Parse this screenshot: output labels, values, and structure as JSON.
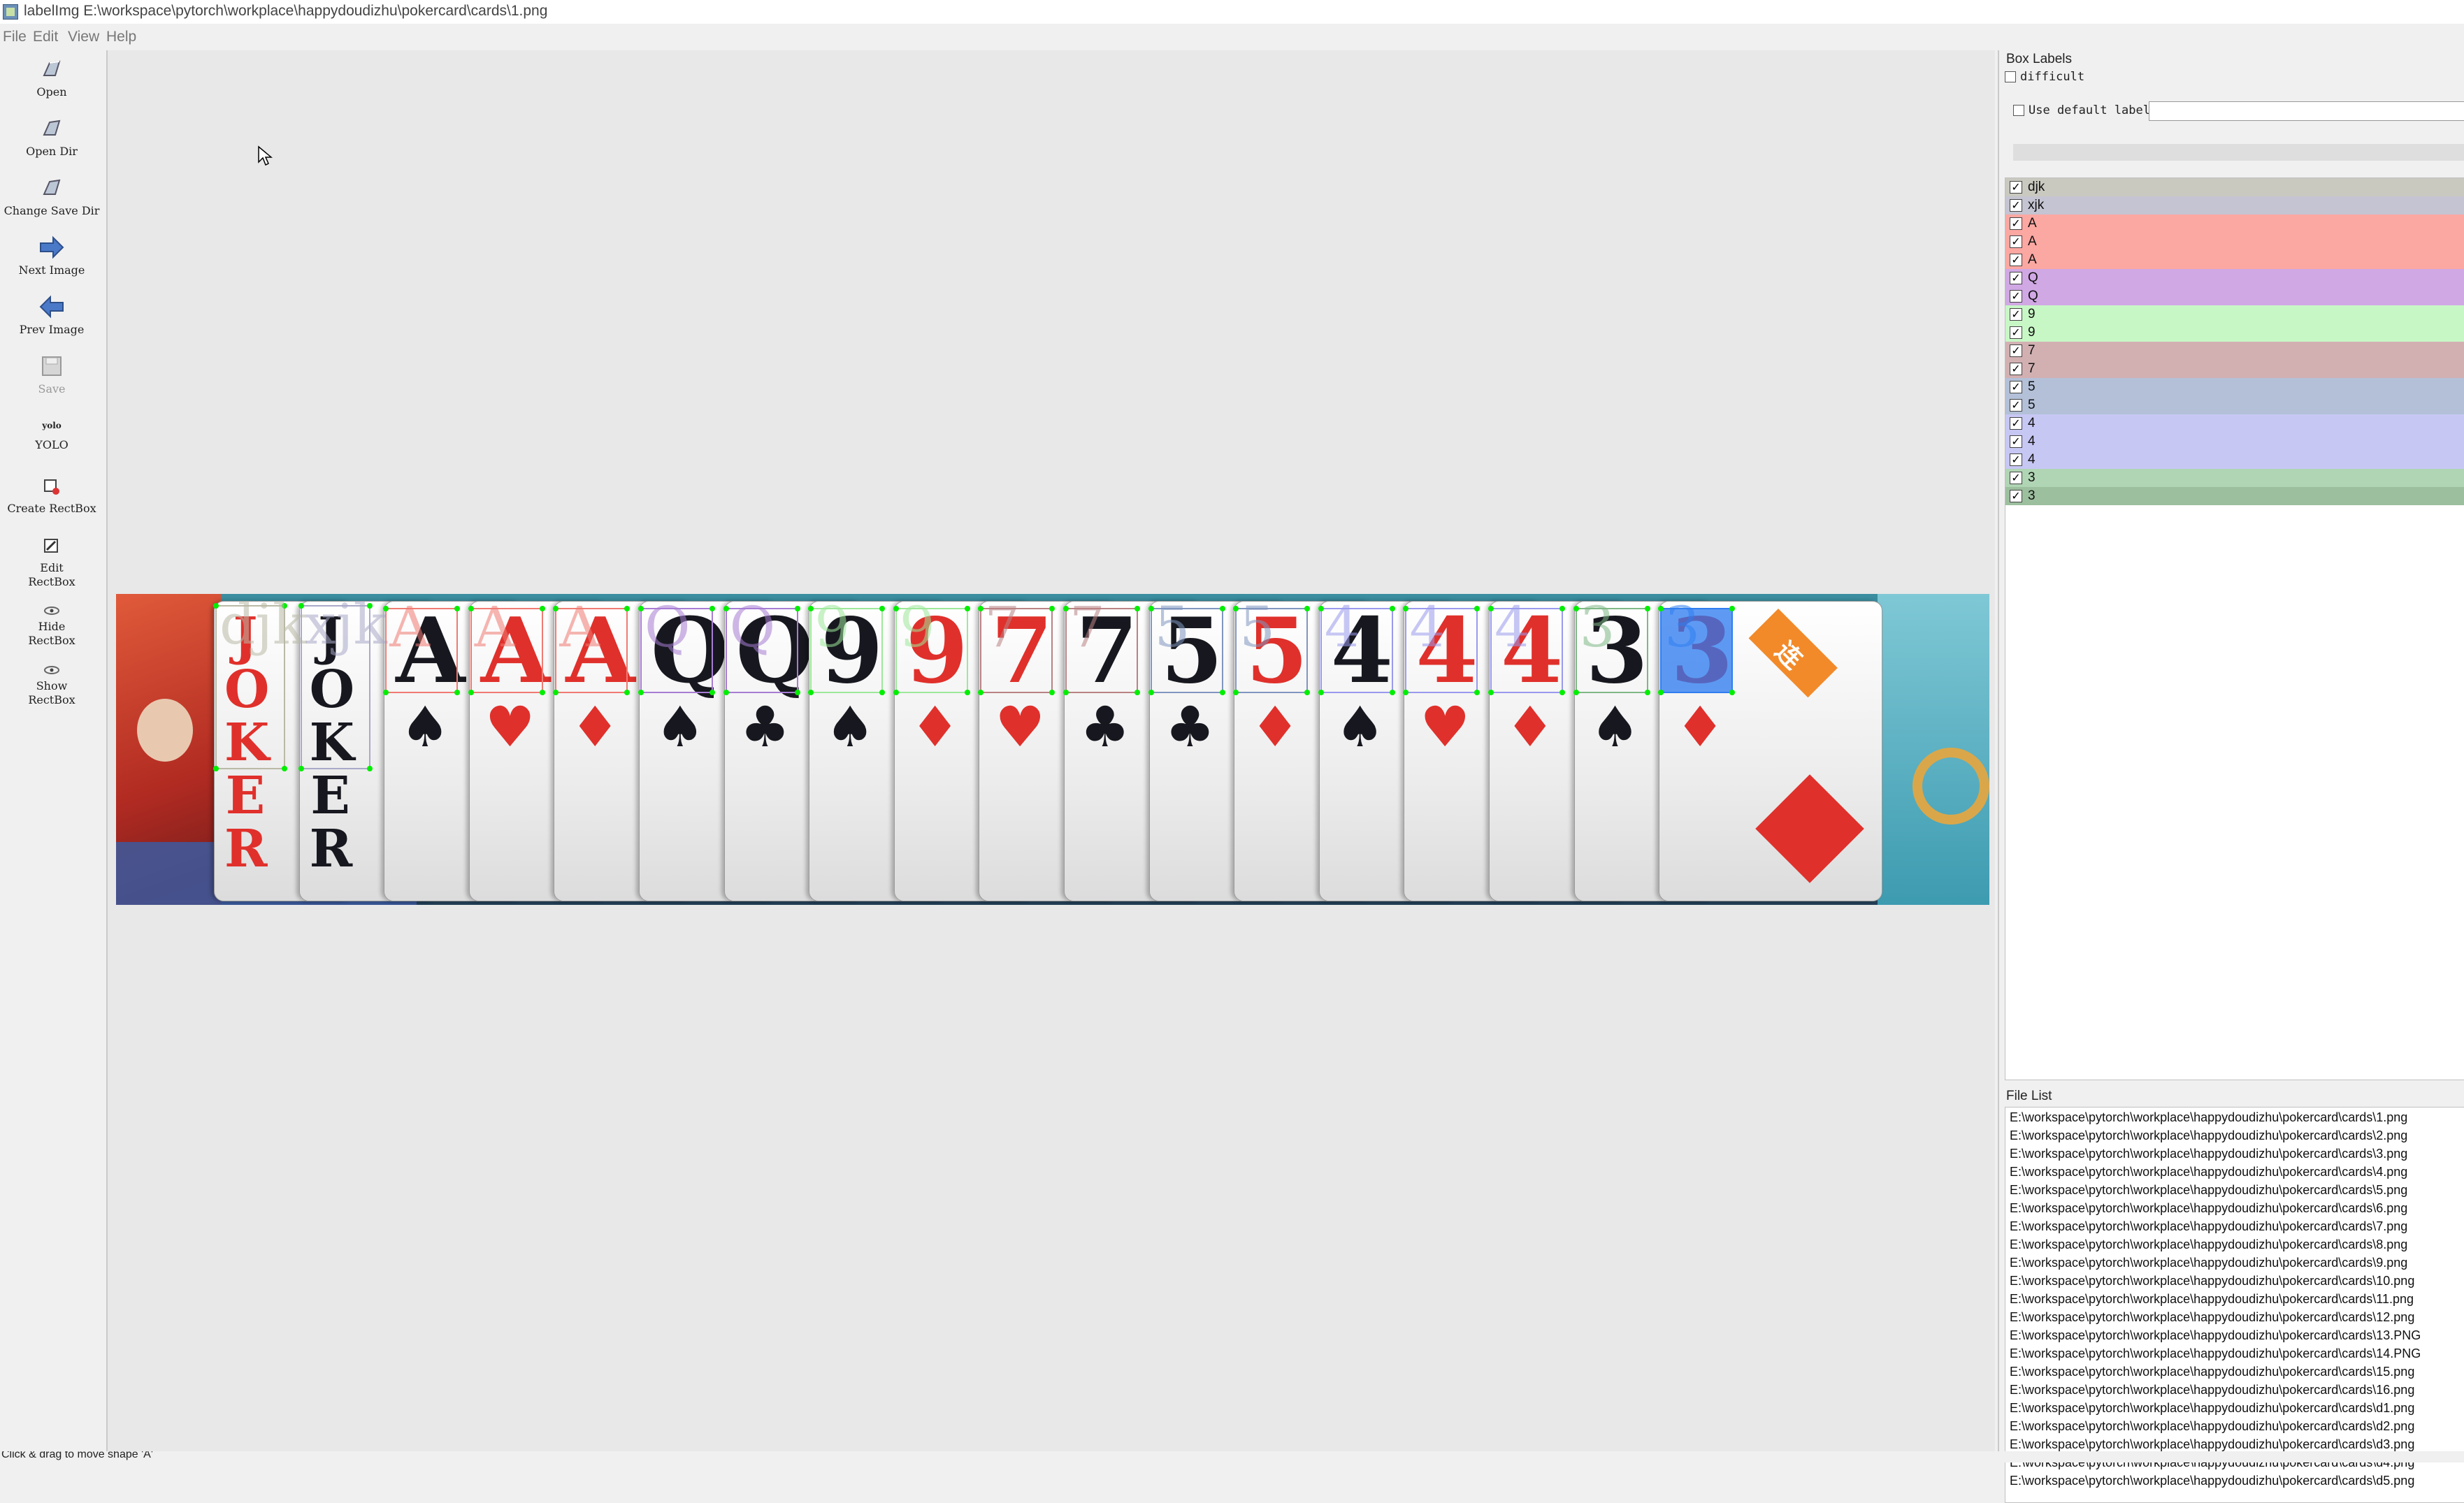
{
  "window": {
    "title": "labelImg E:\\workspace\\pytorch\\workplace\\happydoudizhu\\pokercard\\cards\\1.png",
    "icon": "labelimg-app-icon"
  },
  "menu": [
    "File",
    "Edit",
    "View",
    "Help"
  ],
  "toolbar": [
    {
      "label": "Open",
      "icon": "open-folder-icon",
      "enabled": true
    },
    {
      "label": "Open Dir",
      "icon": "open-dir-icon",
      "enabled": true
    },
    {
      "label": "Change Save Dir",
      "icon": "change-save-dir-icon",
      "enabled": true
    },
    {
      "label": "Next Image",
      "icon": "next-arrow-icon",
      "enabled": true
    },
    {
      "label": "Prev Image",
      "icon": "prev-arrow-icon",
      "enabled": true
    },
    {
      "label": "Save",
      "icon": "save-icon",
      "enabled": false
    },
    {
      "label": "YOLO",
      "icon_text": "yolo",
      "icon": "yolo-format-icon",
      "enabled": true
    },
    {
      "label": "Create RectBox",
      "icon": "create-rectbox-icon",
      "enabled": true
    },
    {
      "label": "Edit RectBox",
      "icon": "edit-rectbox-icon",
      "enabled": true
    },
    {
      "label": "Hide RectBox",
      "icon": "eye-icon",
      "enabled": true
    },
    {
      "label": "Show RectBox",
      "icon": "eye-icon",
      "enabled": true
    }
  ],
  "cards": [
    {
      "rank": "JOKER",
      "suit": "",
      "color": "red"
    },
    {
      "rank": "JOKER",
      "suit": "",
      "color": "black"
    },
    {
      "rank": "A",
      "suit": "♠",
      "color": "black"
    },
    {
      "rank": "A",
      "suit": "♥",
      "color": "red"
    },
    {
      "rank": "A",
      "suit": "♦",
      "color": "red"
    },
    {
      "rank": "Q",
      "suit": "♠",
      "color": "black"
    },
    {
      "rank": "Q",
      "suit": "♣",
      "color": "black"
    },
    {
      "rank": "9",
      "suit": "♠",
      "color": "black"
    },
    {
      "rank": "9",
      "suit": "♦",
      "color": "red"
    },
    {
      "rank": "7",
      "suit": "♥",
      "color": "red"
    },
    {
      "rank": "7",
      "suit": "♣",
      "color": "black"
    },
    {
      "rank": "5",
      "suit": "♣",
      "color": "black"
    },
    {
      "rank": "5",
      "suit": "♦",
      "color": "red"
    },
    {
      "rank": "4",
      "suit": "♠",
      "color": "black"
    },
    {
      "rank": "4",
      "suit": "♥",
      "color": "red"
    },
    {
      "rank": "4",
      "suit": "♦",
      "color": "red"
    },
    {
      "rank": "3",
      "suit": "♠",
      "color": "black"
    },
    {
      "rank": "3",
      "suit": "♦",
      "color": "red"
    }
  ],
  "box_overlay_labels": [
    "djk",
    "xjk",
    "A",
    "A",
    "A",
    "Q",
    "Q",
    "9",
    "9",
    "7",
    "7",
    "5",
    "5",
    "4",
    "4",
    "4",
    "3",
    "3"
  ],
  "ribbon_text": "连",
  "box_labels_panel": {
    "title": "Box Labels",
    "difficult": "difficult",
    "use_default": "Use default label",
    "default_value": ""
  },
  "labels": [
    {
      "text": "djk",
      "color": "#c9c9c0"
    },
    {
      "text": "xjk",
      "color": "#c4c4d2"
    },
    {
      "text": "A",
      "color": "#fba7a2"
    },
    {
      "text": "A",
      "color": "#fba7a2"
    },
    {
      "text": "A",
      "color": "#fba7a2"
    },
    {
      "text": "Q",
      "color": "#d0a8e4"
    },
    {
      "text": "Q",
      "color": "#d0a8e4"
    },
    {
      "text": "9",
      "color": "#c8f7c6"
    },
    {
      "text": "9",
      "color": "#c8f7c6"
    },
    {
      "text": "7",
      "color": "#d2b0b2"
    },
    {
      "text": "7",
      "color": "#d2b0b2"
    },
    {
      "text": "5",
      "color": "#b3c0d8"
    },
    {
      "text": "5",
      "color": "#b3c0d8"
    },
    {
      "text": "4",
      "color": "#c7c7f4"
    },
    {
      "text": "4",
      "color": "#c7c7f4"
    },
    {
      "text": "4",
      "color": "#c7c7f4"
    },
    {
      "text": "3",
      "color": "#b0d5b4"
    },
    {
      "text": "3",
      "color": "#9cbf9e"
    }
  ],
  "file_list": {
    "title": "File List",
    "files": [
      "E:\\workspace\\pytorch\\workplace\\happydoudizhu\\pokercard\\cards\\1.png",
      "E:\\workspace\\pytorch\\workplace\\happydoudizhu\\pokercard\\cards\\2.png",
      "E:\\workspace\\pytorch\\workplace\\happydoudizhu\\pokercard\\cards\\3.png",
      "E:\\workspace\\pytorch\\workplace\\happydoudizhu\\pokercard\\cards\\4.png",
      "E:\\workspace\\pytorch\\workplace\\happydoudizhu\\pokercard\\cards\\5.png",
      "E:\\workspace\\pytorch\\workplace\\happydoudizhu\\pokercard\\cards\\6.png",
      "E:\\workspace\\pytorch\\workplace\\happydoudizhu\\pokercard\\cards\\7.png",
      "E:\\workspace\\pytorch\\workplace\\happydoudizhu\\pokercard\\cards\\8.png",
      "E:\\workspace\\pytorch\\workplace\\happydoudizhu\\pokercard\\cards\\9.png",
      "E:\\workspace\\pytorch\\workplace\\happydoudizhu\\pokercard\\cards\\10.png",
      "E:\\workspace\\pytorch\\workplace\\happydoudizhu\\pokercard\\cards\\11.png",
      "E:\\workspace\\pytorch\\workplace\\happydoudizhu\\pokercard\\cards\\12.png",
      "E:\\workspace\\pytorch\\workplace\\happydoudizhu\\pokercard\\cards\\13.PNG",
      "E:\\workspace\\pytorch\\workplace\\happydoudizhu\\pokercard\\cards\\14.PNG",
      "E:\\workspace\\pytorch\\workplace\\happydoudizhu\\pokercard\\cards\\15.png",
      "E:\\workspace\\pytorch\\workplace\\happydoudizhu\\pokercard\\cards\\16.png",
      "E:\\workspace\\pytorch\\workplace\\happydoudizhu\\pokercard\\cards\\d1.png",
      "E:\\workspace\\pytorch\\workplace\\happydoudizhu\\pokercard\\cards\\d2.png",
      "E:\\workspace\\pytorch\\workplace\\happydoudizhu\\pokercard\\cards\\d3.png",
      "E:\\workspace\\pytorch\\workplace\\happydoudizhu\\pokercard\\cards\\d4.png",
      "E:\\workspace\\pytorch\\workplace\\happydoudizhu\\pokercard\\cards\\d5.png"
    ]
  },
  "status": "Click & drag to move shape 'A'"
}
